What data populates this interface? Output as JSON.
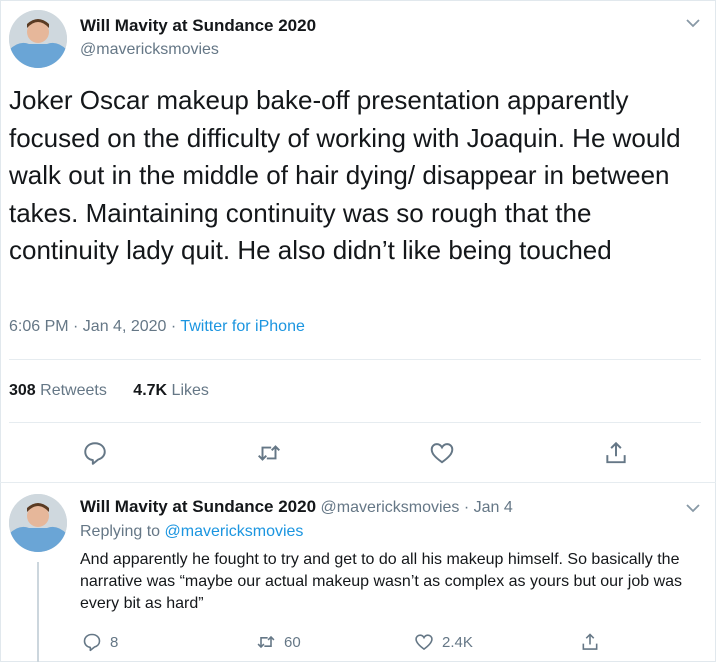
{
  "main_tweet": {
    "author_name": "Will Mavity at Sundance 2020",
    "author_handle": "@mavericksmovies",
    "text": "Joker Oscar makeup bake-off presentation apparently focused on the difficulty of working with Joaquin. He would walk out in the middle of hair dying/ disappear in between takes. Maintaining continuity was so rough that the continuity lady quit. He also didn’t like being touched",
    "time_date": "6:06 PM · Jan 4, 2020 · ",
    "source": "Twitter for iPhone",
    "retweets_count": "308",
    "retweets_label": " Retweets",
    "likes_count": "4.7K",
    "likes_label": " Likes"
  },
  "reply_tweet": {
    "author_name": "Will Mavity at Sundance 2020",
    "author_handle": " @mavericksmovies · Jan 4",
    "replying_prefix": "Replying to ",
    "replying_handle": "@mavericksmovies",
    "text": "And apparently he fought to try and get to do all his makeup himself. So basically the narrative was “maybe our actual makeup wasn’t as complex as yours but our job was every bit as hard”",
    "reply_count": "8",
    "retweet_count": "60",
    "like_count": "2.4K"
  },
  "icons": {
    "menu": "chevron-down-icon",
    "reply": "reply-icon",
    "retweet": "retweet-icon",
    "like": "heart-icon",
    "share": "share-icon"
  },
  "colors": {
    "link": "#1b95e0",
    "muted": "#657786",
    "divider": "#e6ecf0"
  }
}
